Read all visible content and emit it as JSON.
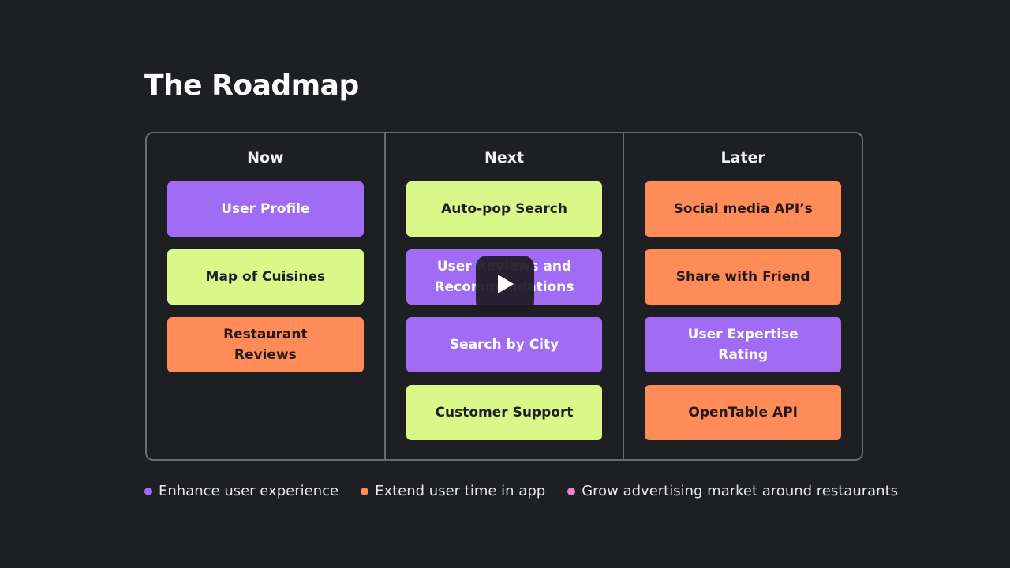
{
  "title": "The Roadmap",
  "columns": [
    {
      "label": "Now",
      "cards": [
        {
          "label": "User Profile",
          "color": "purple"
        },
        {
          "label": "Map of Cuisines",
          "color": "lime"
        },
        {
          "label": "Restaurant Reviews",
          "color": "orange"
        }
      ]
    },
    {
      "label": "Next",
      "cards": [
        {
          "label": "Auto-pop Search",
          "color": "lime"
        },
        {
          "label": "User Reviews and Recommendations",
          "color": "purple"
        },
        {
          "label": "Search by City",
          "color": "purple"
        },
        {
          "label": "Customer Support",
          "color": "lime"
        }
      ]
    },
    {
      "label": "Later",
      "cards": [
        {
          "label": "Social media API’s",
          "color": "orange"
        },
        {
          "label": "Share with Friend",
          "color": "orange"
        },
        {
          "label": "User Expertise Rating",
          "color": "purple"
        },
        {
          "label": "OpenTable API",
          "color": "orange"
        }
      ]
    }
  ],
  "legend": [
    {
      "label": "Enhance user experience",
      "color": "#9d6cf2"
    },
    {
      "label": "Extend user time in app",
      "color": "#ff8a5b"
    },
    {
      "label": "Grow advertising market around restaurants",
      "color": "#e882cf"
    }
  ],
  "video_overlay": {
    "icon": "play-icon"
  }
}
